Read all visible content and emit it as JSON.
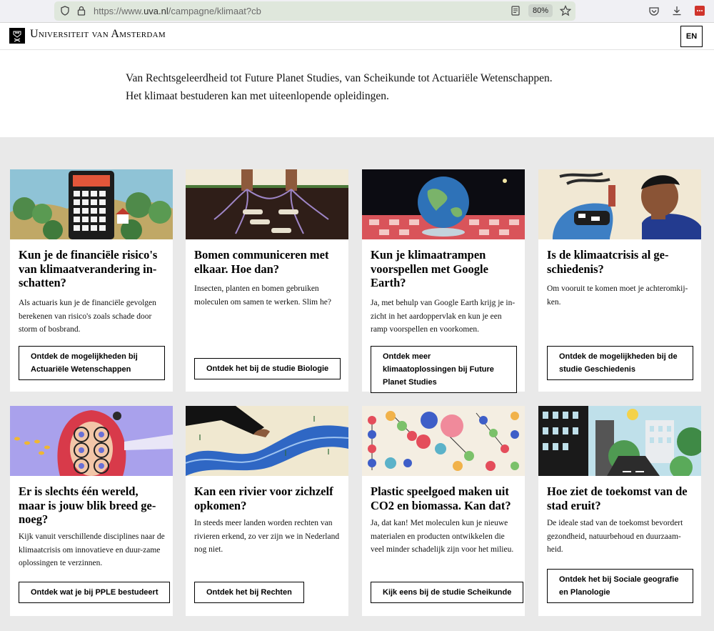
{
  "browser": {
    "url_prefix": "https://www.",
    "url_domain": "uva.nl",
    "url_path": "/campagne/klimaat?cb",
    "zoom": "80%"
  },
  "header": {
    "logo_text": "Universiteit van Amsterdam",
    "lang_label": "EN"
  },
  "intro": {
    "line1": "Van Rechtsgeleerdheid tot Future Planet Studies, van Scheikunde tot Actuariële Wetenschappen.",
    "line2": "Het klimaat bestuderen kan met uiteenlopende opleidingen."
  },
  "cards": [
    {
      "title": "Kun je de financiële risico's van klimaatverandering in-schatten?",
      "text": "Als actuaris kun je de financiële gevolgen berekenen van risico's zoals schade door storm of bosbrand.",
      "button": "Ontdek de mogelijkheden bij Actuariële Wetenschappen"
    },
    {
      "title": "Bomen communiceren met elkaar. Hoe dan?",
      "text": "Insecten, planten en bomen gebruiken moleculen om samen te werken. Slim he?",
      "button": "Ontdek het bij de studie Biologie"
    },
    {
      "title": "Kun je klimaatrampen voorspellen met Google Earth?",
      "text": "Ja, met behulp van Google Earth krijg je in-zicht in het aardoppervlak en kun je een ramp voorspellen en voorkomen.",
      "button": "Ontdek meer klimaatoplossingen bij Future Planet Studies"
    },
    {
      "title": "Is de klimaatcrisis al ge-schiedenis?",
      "text": "Om vooruit te komen moet je achteromkij-ken.",
      "button": "Ontdek de mogelijkheden bij de studie Geschiedenis"
    },
    {
      "title": "Er is slechts één wereld, maar is jouw blik breed ge-noeg?",
      "text": "Kijk vanuit verschillende disciplines naar de klimaatcrisis om innovatieve en duur-zame oplossingen te verzinnen.",
      "button": "Ontdek wat je bij PPLE bestudeert"
    },
    {
      "title": "Kan een rivier voor zichzelf opkomen?",
      "text": "In steeds meer landen worden rechten van rivieren erkend, zo ver zijn we in Nederland nog niet.",
      "button": "Ontdek het bij Rechten"
    },
    {
      "title": "Plastic speelgoed maken uit CO2 en biomassa. Kan dat?",
      "text": "Ja, dat kan! Met moleculen kun je nieuwe materialen en producten ontwikkelen die veel minder schadelijk zijn voor het milieu.",
      "button": "Kijk eens bij de studie Scheikunde"
    },
    {
      "title": "Hoe ziet de toekomst van de stad eruit?",
      "text": "De ideale stad van de toekomst bevordert gezondheid, natuurbehoud en duurzaam-heid.",
      "button": "Ontdek het bij Sociale geografie en Planologie"
    }
  ]
}
